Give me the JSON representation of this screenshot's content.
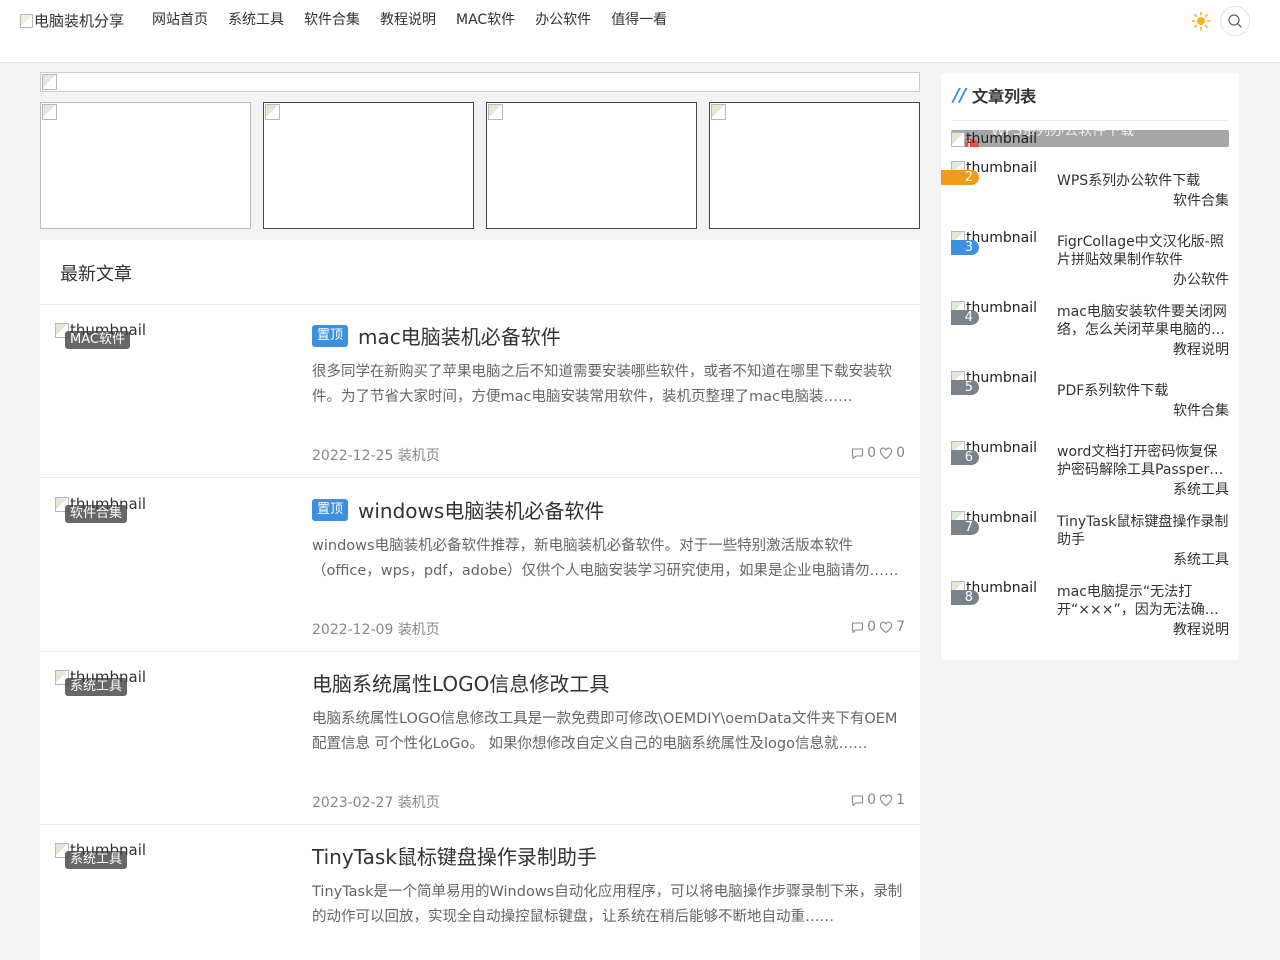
{
  "header": {
    "logo_alt": "电脑装机分享",
    "nav": [
      "网站首页",
      "系统工具",
      "软件合集",
      "教程说明",
      "MAC软件",
      "办公软件",
      "值得一看"
    ]
  },
  "main": {
    "section_title": "最新文章",
    "posts": [
      {
        "thumb_alt": "thumbnail",
        "category": "MAC软件",
        "pinned": "置顶",
        "title": "mac电脑装机必备软件",
        "excerpt": "很多同学在新购买了苹果电脑之后不知道需要安装哪些软件，或者不知道在哪里下载安装软件。为了节省大家时间，方便mac电脑安装常用软件，装机页整理了mac电脑装……",
        "date_author": "2022-12-25 装机页",
        "comments": "0",
        "likes": "0"
      },
      {
        "thumb_alt": "thumbnail",
        "category": "软件合集",
        "pinned": "置顶",
        "title": "windows电脑装机必备软件",
        "excerpt": "windows电脑装机必备软件推荐，新电脑装机必备软件。对于一些特别激活版本软件（office，wps，pdf，adobe）仅供个人电脑安装学习研究使用，如果是企业电脑请勿……",
        "date_author": "2022-12-09 装机页",
        "comments": "0",
        "likes": "7"
      },
      {
        "thumb_alt": "thumbnail",
        "category": "系统工具",
        "pinned": "",
        "title": "电脑系统属性LOGO信息修改工具",
        "excerpt": "电脑系统属性LOGO信息修改工具是一款免费即可修改\\OEMDIY\\oemData文件夹下有OEM配置信息 可个性化LoGo。 如果你想修改自定义自己的电脑系统属性及logo信息就……",
        "date_author": "2023-02-27 装机页",
        "comments": "0",
        "likes": "1"
      },
      {
        "thumb_alt": "thumbnail",
        "category": "系统工具",
        "pinned": "",
        "title": "TinyTask鼠标键盘操作录制助手",
        "excerpt": "TinyTask是一个简单易用的Windows自动化应用程序，可以将电脑操作步骤录制下来，录制的动作可以回放，实现全自动操控鼠标键盘，让系统在稍后能够不断地自动重……",
        "date_author": "",
        "comments": "",
        "likes": ""
      }
    ]
  },
  "sidebar": {
    "title_prefix": "//",
    "title": "文章列表",
    "top_item": {
      "rank": "1",
      "thumb_alt": "thumbnail",
      "title_overlay": "WPS系列办公软件下载"
    },
    "items": [
      {
        "rank": "2",
        "thumb_alt": "thumbnail",
        "title": "WPS系列办公软件下载",
        "category": "软件合集"
      },
      {
        "rank": "3",
        "thumb_alt": "thumbnail",
        "title": "FigrCollage中文汉化版-照片拼贴效果制作软件",
        "category": "办公软件"
      },
      {
        "rank": "4",
        "thumb_alt": "thumbnail",
        "title": "mac电脑安装软件要关闭网络，怎么关闭苹果电脑的…",
        "category": "教程说明"
      },
      {
        "rank": "5",
        "thumb_alt": "thumbnail",
        "title": "PDF系列软件下载",
        "category": "软件合集"
      },
      {
        "rank": "6",
        "thumb_alt": "thumbnail",
        "title": "word文档打开密码恢复保护密码解除工具Passper for…",
        "category": "系统工具"
      },
      {
        "rank": "7",
        "thumb_alt": "thumbnail",
        "title": "TinyTask鼠标键盘操作录制助手",
        "category": "系统工具"
      },
      {
        "rank": "8",
        "thumb_alt": "thumbnail",
        "title": "mac电脑提示“无法打开“×××”，因为无法确认开发者…",
        "category": "教程说明"
      }
    ]
  },
  "colors": {
    "accent": "#3d8fe0",
    "rank1": "#e0504b",
    "rank2": "#f39a1b",
    "rank3": "#3d8fe0",
    "rank_other": "#7a838c"
  }
}
